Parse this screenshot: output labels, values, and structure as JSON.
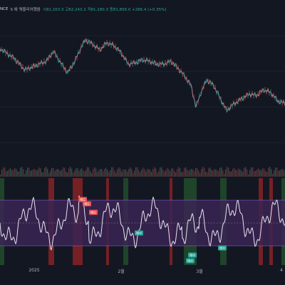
{
  "legend": {
    "symbol": "NCE",
    "indicator": "S 에 쿼블리어했음",
    "ohlc": "시81,163.3 고82,243.2 저81,180.3 종81,856.0 +286.4 (+0.35%)"
  },
  "xaxis": {
    "labels": [
      "2025",
      "2월",
      "3월",
      "4"
    ]
  },
  "markers": [
    {
      "text": "매도",
      "type": "sell"
    },
    {
      "text": "매도",
      "type": "sell"
    },
    {
      "text": "매도",
      "type": "sell"
    },
    {
      "text": "매수",
      "type": "buy"
    },
    {
      "text": "매수",
      "type": "buy"
    },
    {
      "text": "매수",
      "type": "buy"
    },
    {
      "text": "매수",
      "type": "buy"
    }
  ],
  "colors": {
    "background": "#131722",
    "price_line": "#8b8e97",
    "bull": "#26a69a",
    "bear": "#ef5350",
    "oscillator": "#e6e6f0",
    "band_fill": "#3a2552",
    "buy_zone": "#2e7d32",
    "sell_zone": "#c62828"
  }
}
